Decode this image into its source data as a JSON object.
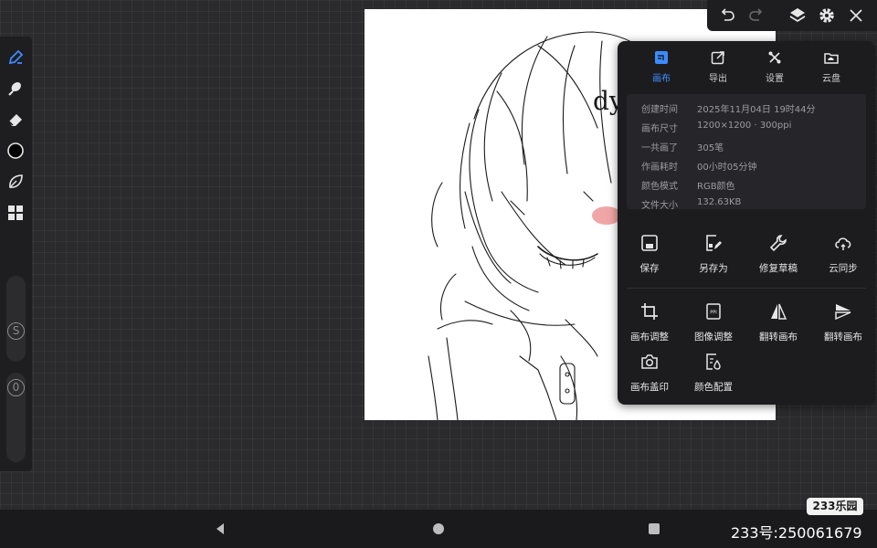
{
  "left_toolbar": {
    "tools": [
      {
        "icon": "pen-icon",
        "name": "pen-tool"
      },
      {
        "icon": "smudge-icon",
        "name": "smudge-tool"
      },
      {
        "icon": "eraser-icon",
        "name": "eraser-tool"
      },
      {
        "icon": "color-circle-icon",
        "name": "color-picker"
      },
      {
        "icon": "leaf-icon",
        "name": "brush-library"
      },
      {
        "icon": "grid-icon",
        "name": "material-grid"
      }
    ],
    "size_slider_label": "S",
    "opacity_slider_label": "0"
  },
  "canvas": {
    "doodle_text": "dy"
  },
  "top_toolbar": {
    "icons": [
      "undo-icon",
      "redo-icon",
      "layers-icon",
      "settings-icon",
      "close-icon"
    ]
  },
  "panel": {
    "tabs": [
      {
        "label": "画布",
        "icon": "canvas-icon",
        "active": true
      },
      {
        "label": "导出",
        "icon": "export-icon",
        "active": false
      },
      {
        "label": "设置",
        "icon": "tools-icon",
        "active": false
      },
      {
        "label": "云盘",
        "icon": "cloud-folder-icon",
        "active": false
      }
    ],
    "info": [
      {
        "label": "创建时间",
        "value": "2025年11月04日 19时44分"
      },
      {
        "label": "画布尺寸",
        "value": "1200×1200 · 300ppi"
      },
      {
        "label": "一共画了",
        "value": "305笔"
      },
      {
        "label": "作画耗时",
        "value": "00小时05分钟"
      },
      {
        "label": "颜色模式",
        "value": "RGB颜色"
      },
      {
        "label": "文件大小",
        "value": "132.63KB"
      }
    ],
    "actions_row1": [
      {
        "label": "保存",
        "icon": "save-icon"
      },
      {
        "label": "另存为",
        "icon": "save-as-icon"
      },
      {
        "label": "修复草稿",
        "icon": "wrench-icon"
      },
      {
        "label": "云同步",
        "icon": "cloud-sync-icon"
      }
    ],
    "actions_row2": [
      {
        "label": "画布调整",
        "icon": "crop-icon"
      },
      {
        "label": "图像调整",
        "icon": "image-adjust-icon"
      },
      {
        "label": "翻转画布",
        "icon": "flip-horizontal-icon"
      },
      {
        "label": "翻转画布",
        "icon": "flip-vertical-icon"
      }
    ],
    "actions_row3": [
      {
        "label": "画布盖印",
        "icon": "camera-icon"
      },
      {
        "label": "颜色配置",
        "icon": "color-config-icon"
      }
    ]
  },
  "accent_color": "#3d8bff",
  "watermark": {
    "logo": "233乐园",
    "id_text": "233号:250061679"
  }
}
